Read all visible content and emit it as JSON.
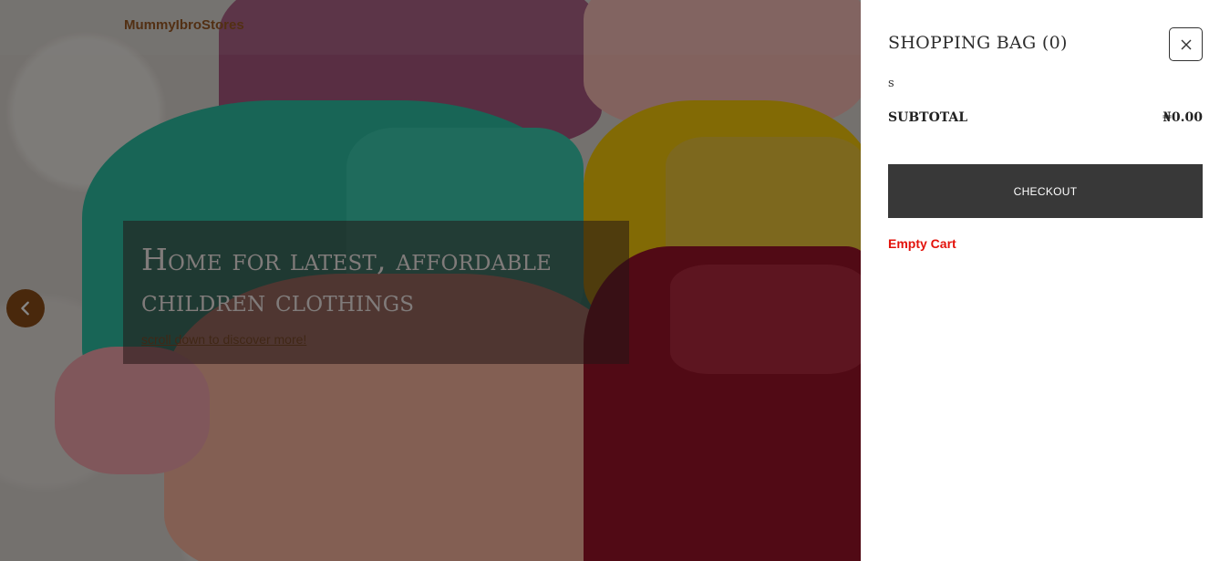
{
  "header": {
    "brand": "MummyIbroStores"
  },
  "hero": {
    "title": "Home for latest, affordable children clothings",
    "link_text": "scroll down to discover more!",
    "prev_icon": "chevron-left-icon"
  },
  "cart": {
    "title": "SHOPPING BAG (0)",
    "close_icon": "close-icon",
    "stray_text": "s",
    "subtotal_label": "SUBTOTAL",
    "subtotal_value": "₦0.00",
    "checkout_label": "CHECKOUT",
    "empty_cart_label": "Empty Cart"
  },
  "colors": {
    "brand": "#9c5a25",
    "checkout_bg": "#383838",
    "empty_cart": "#e3120b"
  }
}
